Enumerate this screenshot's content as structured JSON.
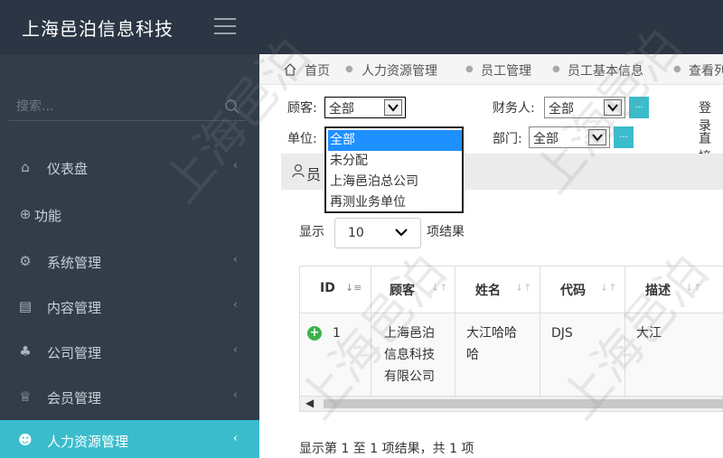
{
  "app": {
    "brand": "上海邑泊信息科技"
  },
  "sidebar": {
    "search_placeholder": "搜索...",
    "items": [
      {
        "label": "仪表盘",
        "icon": "home-icon",
        "has_chevron": true
      },
      {
        "label": "功能",
        "icon": "globe-icon",
        "has_chevron": false
      },
      {
        "label": "系统管理",
        "icon": "gears-icon",
        "has_chevron": true
      },
      {
        "label": "内容管理",
        "icon": "id-card-icon",
        "has_chevron": true
      },
      {
        "label": "公司管理",
        "icon": "sitemap-icon",
        "has_chevron": true
      },
      {
        "label": "会员管理",
        "icon": "trophy-icon",
        "has_chevron": true
      },
      {
        "label": "人力资源管理",
        "icon": "users-icon",
        "has_chevron": true,
        "active": true
      }
    ]
  },
  "breadcrumb": [
    "首页",
    "人力资源管理",
    "员工管理",
    "员工基本信息",
    "查看列"
  ],
  "filters": {
    "customer_label": "顾客:",
    "customer_value": "全部",
    "finance_label": "财务人:",
    "finance_value": "全部",
    "login_label": "登录",
    "unit_label": "单位:",
    "unit_value": "全部",
    "dept_label": "部门:",
    "dept_value": "全部",
    "direct_label": "直接",
    "dots": "..."
  },
  "dropdown": {
    "options": [
      "全部",
      "未分配",
      "上海邑泊总公司",
      "再测业务单位"
    ],
    "selected": 0
  },
  "panel": {
    "title": "员"
  },
  "length": {
    "show": "显示",
    "value": "10",
    "suffix": "项结果"
  },
  "table": {
    "columns": [
      "ID",
      "顾客",
      "姓名",
      "代码",
      "描述"
    ],
    "rows": [
      {
        "id": "1",
        "customer": [
          "上海邑泊",
          "信息科技",
          "有限公司"
        ],
        "name": [
          "大江哈哈",
          "哈"
        ],
        "code": "DJS",
        "desc": "大江"
      }
    ]
  },
  "info": "显示第 1 至 1 项结果，共 1 项",
  "watermark": "上海邑泊",
  "colors": {
    "topbar": "#2b3543",
    "sidebar": "#333d4a",
    "accent": "#3bbccd",
    "selected_option": "#1e90ff"
  }
}
